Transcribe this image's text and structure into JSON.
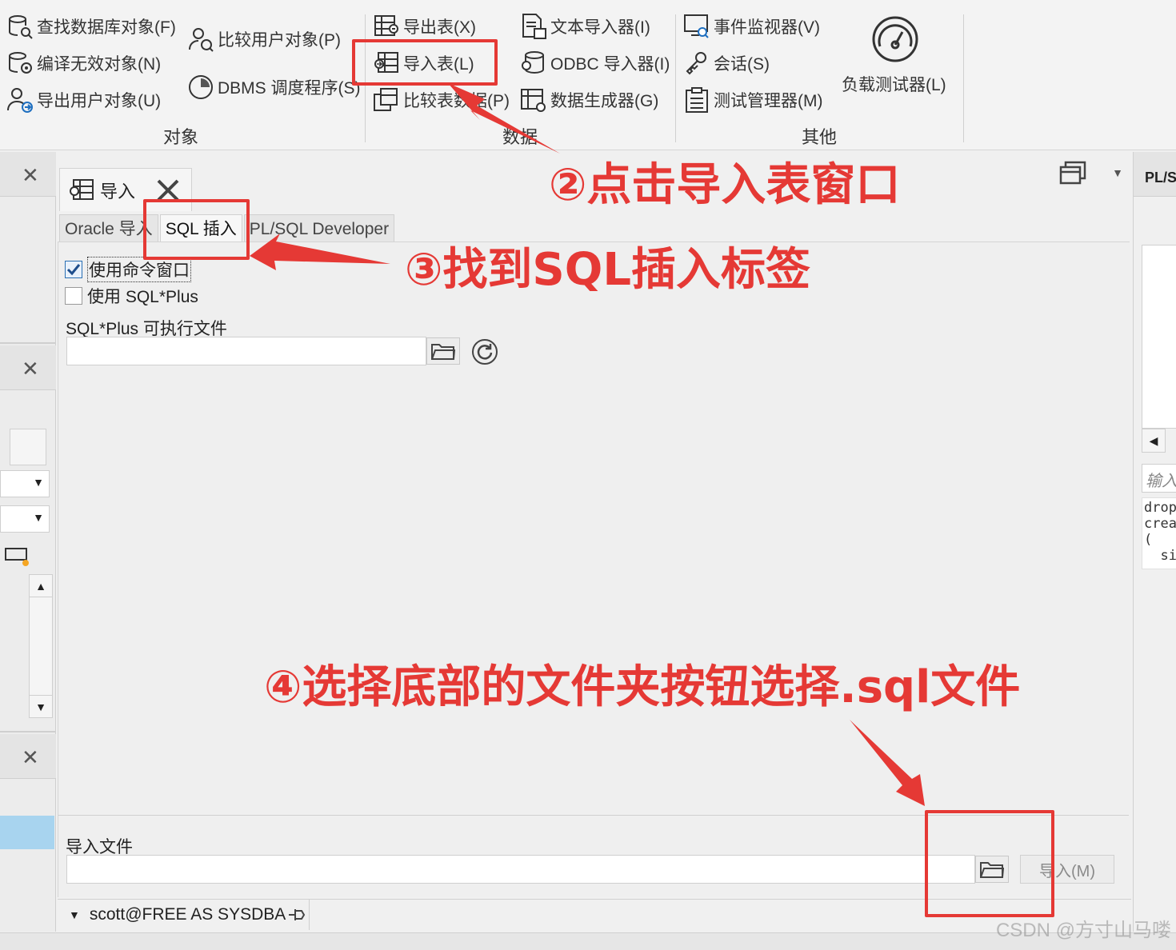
{
  "ribbon": {
    "objects": {
      "find_db_objects": "查找数据库对象(F)",
      "compile_invalid": "编译无效对象(N)",
      "export_user_objects": "导出用户对象(U)",
      "compare_user_objects": "比较用户对象(P)",
      "dbms_scheduler": "DBMS 调度程序(S)",
      "group_label": "对象"
    },
    "data": {
      "export_tables": "导出表(X)",
      "import_tables": "导入表(L)",
      "compare_data": "比较表数据(P)",
      "text_importer": "文本导入器(I)",
      "odbc_importer": "ODBC 导入器(I)",
      "data_generator": "数据生成器(G)",
      "group_label": "数据"
    },
    "other": {
      "event_monitor": "事件监视器(V)",
      "sessions": "会话(S)",
      "test_manager": "测试管理器(M)",
      "load_tester": "负载测试器(L)",
      "group_label": "其他"
    }
  },
  "document": {
    "tab_title": "导入",
    "subtabs": [
      "Oracle 导入",
      "SQL 插入",
      "PL/SQL Developer"
    ],
    "use_command_window": "使用命令窗口",
    "use_sqlplus": "使用 SQL*Plus",
    "sqlplus_exe_label": "SQL*Plus 可执行文件",
    "import_file_label": "导入文件",
    "import_button": "导入(M)",
    "status_connection": "scott@FREE AS SYSDBA"
  },
  "right_panel": {
    "header": "PL/S",
    "input_placeholder": "输入",
    "code_lines": [
      "drop",
      "crea",
      "(",
      "  si"
    ]
  },
  "annotations": {
    "step2": "②点击导入表窗口",
    "step3": "③找到SQL插入标签",
    "step4": "④选择底部的文件夹按钮选择.sql文件",
    "color": "#e53935"
  },
  "watermark": "CSDN @方寸山马喽"
}
